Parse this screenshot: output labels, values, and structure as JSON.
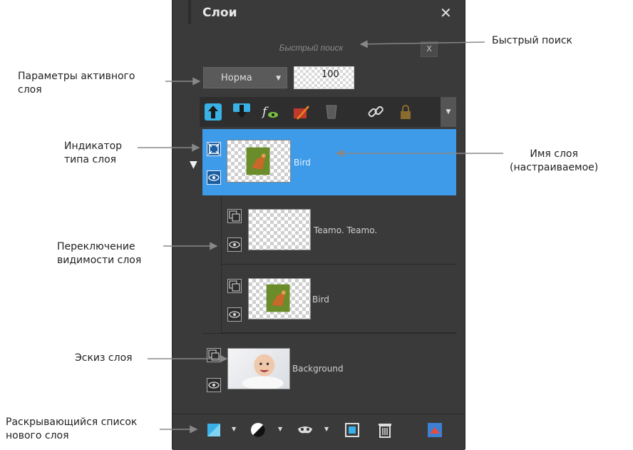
{
  "panel": {
    "title": "Слои",
    "search_placeholder": "Быстрый поиск",
    "search_clear": "X",
    "blend_mode": "Норма",
    "opacity": "100"
  },
  "layers": [
    {
      "name": "Bird",
      "selected": true
    },
    {
      "name": "Teamo. Teamo.",
      "selected": false
    },
    {
      "name": "Bird",
      "selected": false
    },
    {
      "name": "Background",
      "selected": false
    }
  ],
  "callouts": {
    "quick_search": "Быстрый поиск",
    "active_params_1": "Параметры активного",
    "active_params_2": "слоя",
    "type_indicator_1": "Индикатор",
    "type_indicator_2": "типа слоя",
    "layer_name_1": "Имя слоя",
    "layer_name_2": "(настраиваемое)",
    "visibility_1": "Переключение",
    "visibility_2": "видимости слоя",
    "thumbnail": "Эскиз слоя",
    "new_layer_1": "Раскрывающийся список",
    "new_layer_2": "нового слоя"
  },
  "colors": {
    "panel_bg": "#3a3a3a",
    "selection": "#3d9be9",
    "toolbar_accent": "#39b1e6"
  },
  "icons": {
    "toolbar": [
      "move-up-icon",
      "move-down-icon",
      "fx-visibility-icon",
      "brush-icon",
      "mask-icon",
      "link-icon",
      "lock-icon"
    ],
    "bottom": [
      "new-layer-icon",
      "adjustment-icon",
      "mask-icon",
      "group-icon",
      "trash-icon",
      "merge-icon"
    ]
  }
}
